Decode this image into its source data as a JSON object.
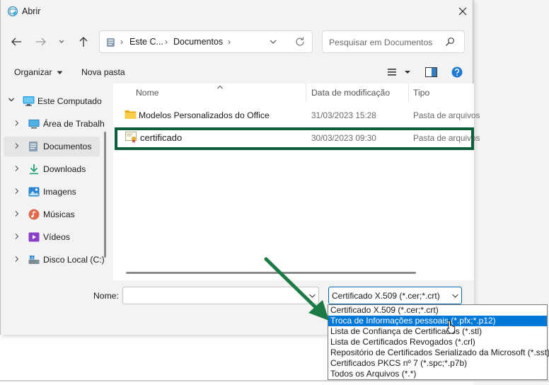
{
  "window": {
    "title": "Abrir"
  },
  "address": {
    "crumbs": [
      "Este C...",
      "Documentos"
    ]
  },
  "search": {
    "placeholder": "Pesquisar em Documentos"
  },
  "toolbar": {
    "organize": "Organizar",
    "new_folder": "Nova pasta"
  },
  "nav": {
    "items": [
      {
        "label": "Este Computado",
        "icon": "computer-icon"
      },
      {
        "label": "Área de Trabalh",
        "icon": "desktop-icon"
      },
      {
        "label": "Documentos",
        "icon": "documents-icon",
        "selected": true
      },
      {
        "label": "Downloads",
        "icon": "downloads-icon"
      },
      {
        "label": "Imagens",
        "icon": "pictures-icon"
      },
      {
        "label": "Músicas",
        "icon": "music-icon"
      },
      {
        "label": "Vídeos",
        "icon": "videos-icon"
      },
      {
        "label": "Disco Local (C:)",
        "icon": "drive-icon"
      }
    ]
  },
  "columns": {
    "name": "Nome",
    "date": "Data de modificação",
    "type": "Tipo"
  },
  "files": [
    {
      "name": "Modelos Personalizados do Office",
      "date": "31/03/2023 15:28",
      "type": "Pasta de arquivos",
      "icon": "folder-icon"
    },
    {
      "name": "certificado",
      "date": "30/03/2023 09:30",
      "type": "Pasta de arquivos",
      "icon": "certificate-icon"
    }
  ],
  "bottom": {
    "name_label": "Nome:",
    "name_value": "",
    "file_type_selected": "Certificado X.509 (*.cer;*.crt)",
    "file_type_options": [
      "Certificado X.509 (*.cer;*.crt)",
      "Troca de Informações pessoais (*.pfx;*.p12)",
      "Lista de Confiança de Certificados (*.stl)",
      "Lista de Certificados Revogados (*.crl)",
      "Repositório de Certificados Serializado da Microsoft (*.sst)",
      "Certificados PKCS nº 7 (*.spc;*.p7b)",
      "Todos os Arquivos (*.*)"
    ],
    "highlighted_option_index": 1
  },
  "colors": {
    "accent": "#0078d7",
    "annotation_green": "#0e5e3a",
    "folder": "#f5c542"
  }
}
